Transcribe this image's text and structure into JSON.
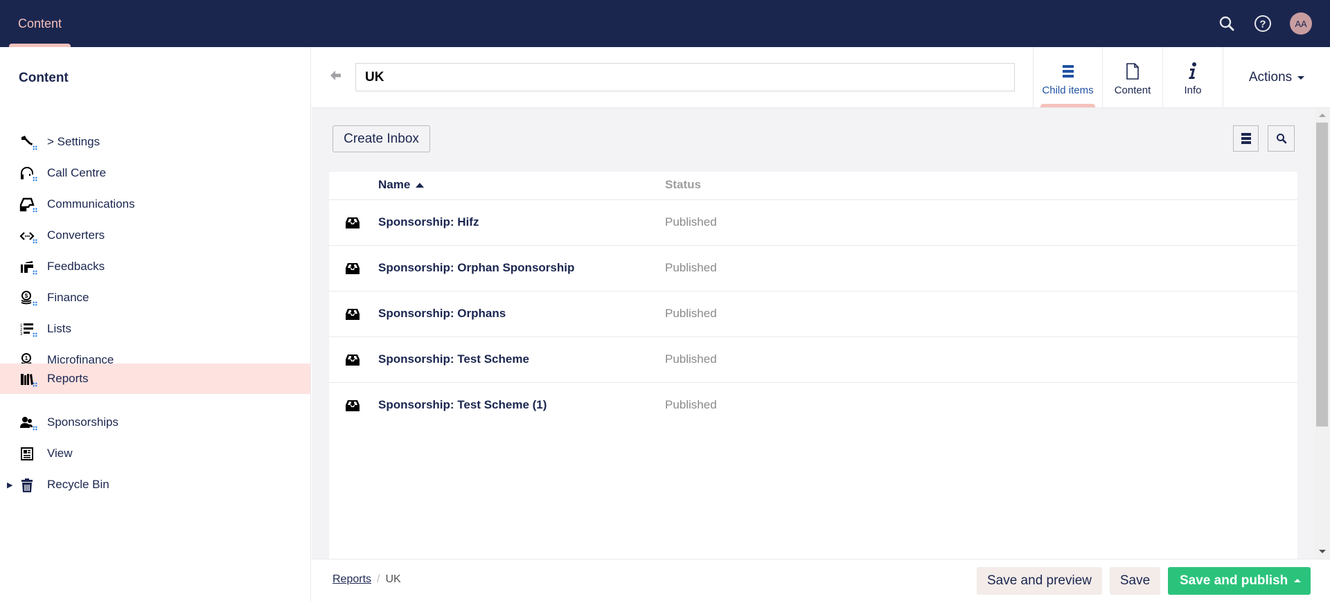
{
  "topbar": {
    "sections": [
      {
        "label": "Content",
        "active": true
      }
    ],
    "tools": [
      {
        "name": "search",
        "icon": "search-icon"
      },
      {
        "name": "help",
        "icon": "help-icon"
      }
    ],
    "avatar_initials": "AA"
  },
  "sidebar": {
    "title": "Content",
    "items": [
      {
        "label": "> Settings",
        "icon": "wrench-icon",
        "has_children_dots": true,
        "active": false,
        "expandable": false
      },
      {
        "label": "Call Centre",
        "icon": "headset-icon",
        "has_children_dots": true,
        "active": false,
        "expandable": false
      },
      {
        "label": "Communications",
        "icon": "inbox-tray-icon",
        "has_children_dots": true,
        "active": false,
        "expandable": false
      },
      {
        "label": "Converters",
        "icon": "code-arrows-icon",
        "has_children_dots": true,
        "active": false,
        "expandable": false
      },
      {
        "label": "Feedbacks",
        "icon": "feedback-icon",
        "has_children_dots": true,
        "active": false,
        "expandable": false
      },
      {
        "label": "Finance",
        "icon": "coins-dollar-icon",
        "has_children_dots": true,
        "active": false,
        "expandable": false
      },
      {
        "label": "Lists",
        "icon": "numbered-list-icon",
        "has_children_dots": true,
        "active": false,
        "expandable": false
      },
      {
        "label": "Microfinance",
        "icon": "coins-one-icon",
        "has_children_dots": true,
        "active": false,
        "expandable": false
      },
      {
        "label": "Reports",
        "icon": "books-icon",
        "has_children_dots": true,
        "active": true,
        "expandable": false
      },
      {
        "label": "Sponsorships",
        "icon": "users-icon",
        "has_children_dots": true,
        "active": false,
        "expandable": false
      },
      {
        "label": "View",
        "icon": "newspaper-icon",
        "has_children_dots": false,
        "active": false,
        "expandable": false
      },
      {
        "label": "Recycle Bin",
        "icon": "trash-icon",
        "has_children_dots": false,
        "active": false,
        "expandable": true
      }
    ]
  },
  "editor": {
    "name_value": "UK",
    "tabs": [
      {
        "label": "Child items",
        "icon": "list-icon",
        "active": true
      },
      {
        "label": "Content",
        "icon": "document-icon",
        "active": false
      },
      {
        "label": "Info",
        "icon": "info-icon",
        "active": false
      }
    ],
    "actions_label": "Actions"
  },
  "listview": {
    "create_button": "Create Inbox",
    "columns": {
      "name": "Name",
      "status": "Status",
      "sort": "ascending"
    },
    "rows": [
      {
        "name": "Sponsorship: Hifz",
        "status": "Published"
      },
      {
        "name": "Sponsorship: Orphan Sponsorship",
        "status": "Published"
      },
      {
        "name": "Sponsorship: Orphans",
        "status": "Published"
      },
      {
        "name": "Sponsorship: Test Scheme",
        "status": "Published"
      },
      {
        "name": "Sponsorship: Test Scheme (1)",
        "status": "Published"
      }
    ]
  },
  "footer": {
    "breadcrumb": [
      {
        "label": "Reports",
        "link": true
      },
      {
        "label": "UK",
        "link": false
      }
    ],
    "breadcrumb_separator": "/",
    "buttons": {
      "save_preview": "Save and preview",
      "save": "Save",
      "save_publish": "Save and publish"
    }
  },
  "colors": {
    "topbar": "#1b264f",
    "accent_pink": "#f5c1bc",
    "active_row": "#fde2e0",
    "publish_green": "#2bc37c",
    "active_tab_text": "#2152a3"
  }
}
